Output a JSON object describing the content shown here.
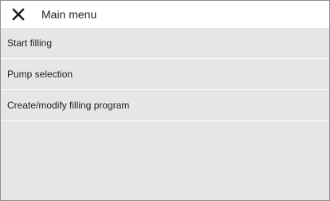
{
  "header": {
    "title": "Main menu",
    "close_icon": "close-icon"
  },
  "menu": {
    "items": [
      {
        "label": "Start filling"
      },
      {
        "label": "Pump selection"
      },
      {
        "label": "Create/modify filling program"
      }
    ]
  },
  "colors": {
    "background": "#e6e6e6",
    "header_background": "#ffffff",
    "text": "#202020",
    "separator": "#ffffff"
  }
}
